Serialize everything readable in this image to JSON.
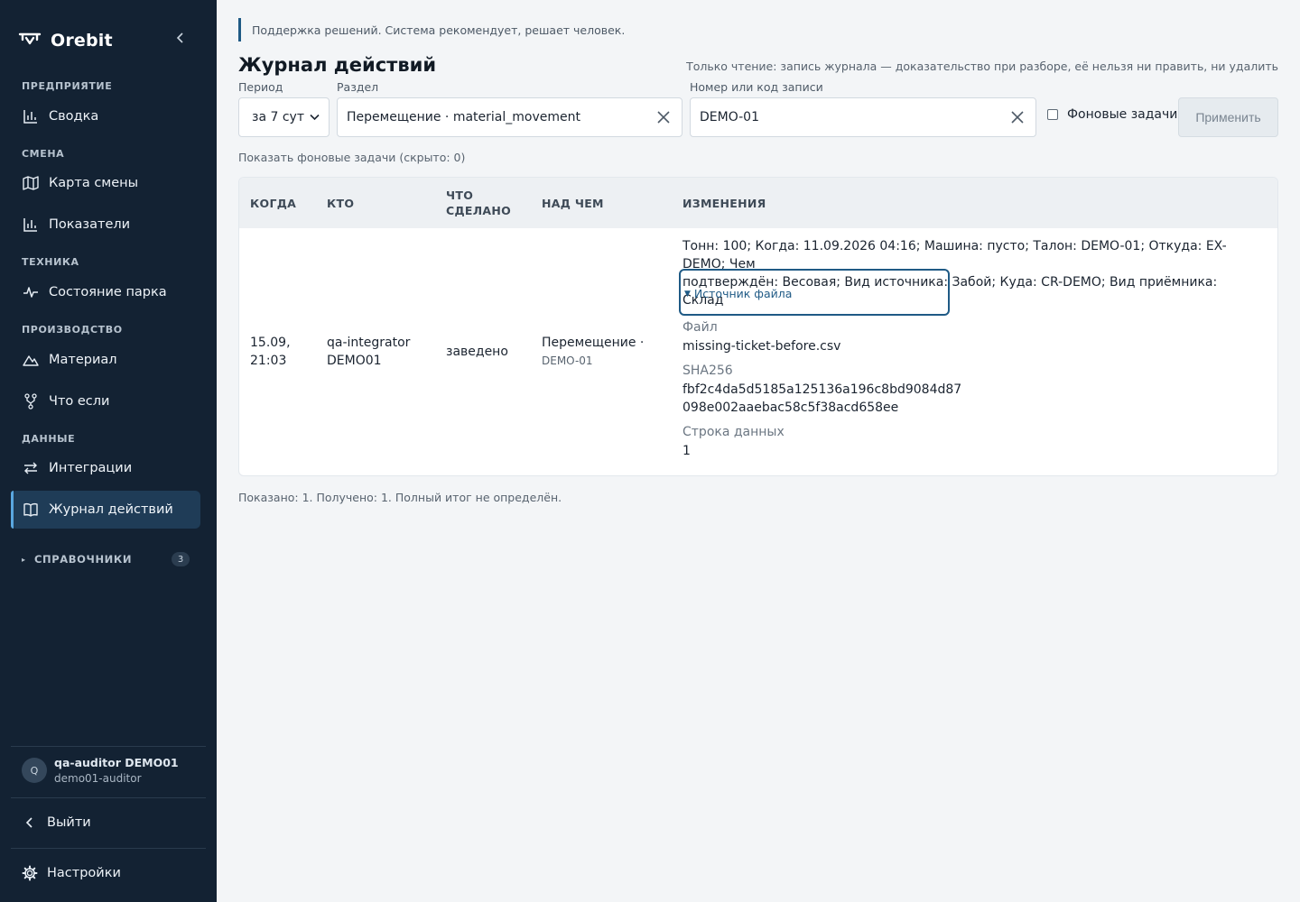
{
  "app": {
    "name": "Orebit"
  },
  "sidebar": {
    "sections": [
      {
        "label": "ПРЕДПРИЯТИЕ",
        "items": [
          {
            "label": "Сводка",
            "icon": "bar-chart-icon"
          }
        ]
      },
      {
        "label": "СМЕНА",
        "items": [
          {
            "label": "Карта смены",
            "icon": "map-icon"
          },
          {
            "label": "Показатели",
            "icon": "bar-chart-icon"
          }
        ]
      },
      {
        "label": "ТЕХНИКА",
        "items": [
          {
            "label": "Состояние парка",
            "icon": "pulse-icon"
          }
        ]
      },
      {
        "label": "ПРОИЗВОДСТВО",
        "items": [
          {
            "label": "Материал",
            "icon": "mountain-icon"
          },
          {
            "label": "Что если",
            "icon": "fork-icon"
          }
        ]
      },
      {
        "label": "ДАННЫЕ",
        "items": [
          {
            "label": "Интеграции",
            "icon": "arrows-icon"
          },
          {
            "label": "Журнал действий",
            "icon": "book-icon",
            "active": true
          }
        ]
      }
    ],
    "references": {
      "label": "СПРАВОЧНИКИ",
      "count": "3"
    },
    "user": {
      "initial": "Q",
      "name": "qa-auditor DEMO01",
      "login": "demo01-auditor"
    },
    "logout_label": "Выйти",
    "settings_label": "Настройки"
  },
  "banner": "Поддержка решений. Система рекомендует, решает человек.",
  "page": {
    "title": "Журнал действий",
    "readonly_note": "Только чтение: запись журнала — доказательство при разборе, её нельзя ни править, ни удалить"
  },
  "filters": {
    "period": {
      "label": "Период",
      "value": "за 7 сут"
    },
    "section": {
      "label": "Раздел",
      "value": "Перемещение · material_movement"
    },
    "record": {
      "label": "Номер или код записи",
      "value": "DEMO-01"
    },
    "background_tasks": {
      "label": "Фоновые задачи",
      "checked": false
    },
    "apply_label": "Применить"
  },
  "show_background_link": "Показать фоновые задачи (скрыто: 0)",
  "table": {
    "headers": {
      "when": "КОГДА",
      "who": "КТО",
      "what_line1": "ЧТО",
      "what_line2": "СДЕЛАНО",
      "target": "НАД ЧЕМ",
      "changes": "ИЗМЕНЕНИЯ"
    },
    "rows": [
      {
        "when_line1": "15.09,",
        "when_line2": "21:03",
        "who_line1": "qa-integrator",
        "who_line2": "DEMO01",
        "action": "заведено",
        "target_main": "Перемещение ·",
        "target_code": "DEMO-01",
        "changes_line1": "Тонн: 100; Когда: 11.09.2026 04:16; Машина: пусто; Талон: DEMO-01; Откуда: EX-DEMO; Чем",
        "changes_line2": "подтверждён: Весовая; Вид источника: Забой; Куда: CR-DEMO; Вид приёмника: Склад",
        "source_label": "Источник файла",
        "file_label": "Файл",
        "file_value": "missing-ticket-before.csv",
        "sha_label": "SHA256",
        "sha_line1": "fbf2c4da5d5185a125136a196c8bd9084d87",
        "sha_line2": "098e002aaebac58c5f38acd658ee",
        "row_label": "Строка данных",
        "row_value": "1"
      }
    ]
  },
  "footer_note": "Показано: 1. Получено: 1. Полный итог не определён.",
  "colors": {
    "sidebar_bg": "#132233",
    "accent": "#1f5a85",
    "active_item": "#1f3c57"
  }
}
